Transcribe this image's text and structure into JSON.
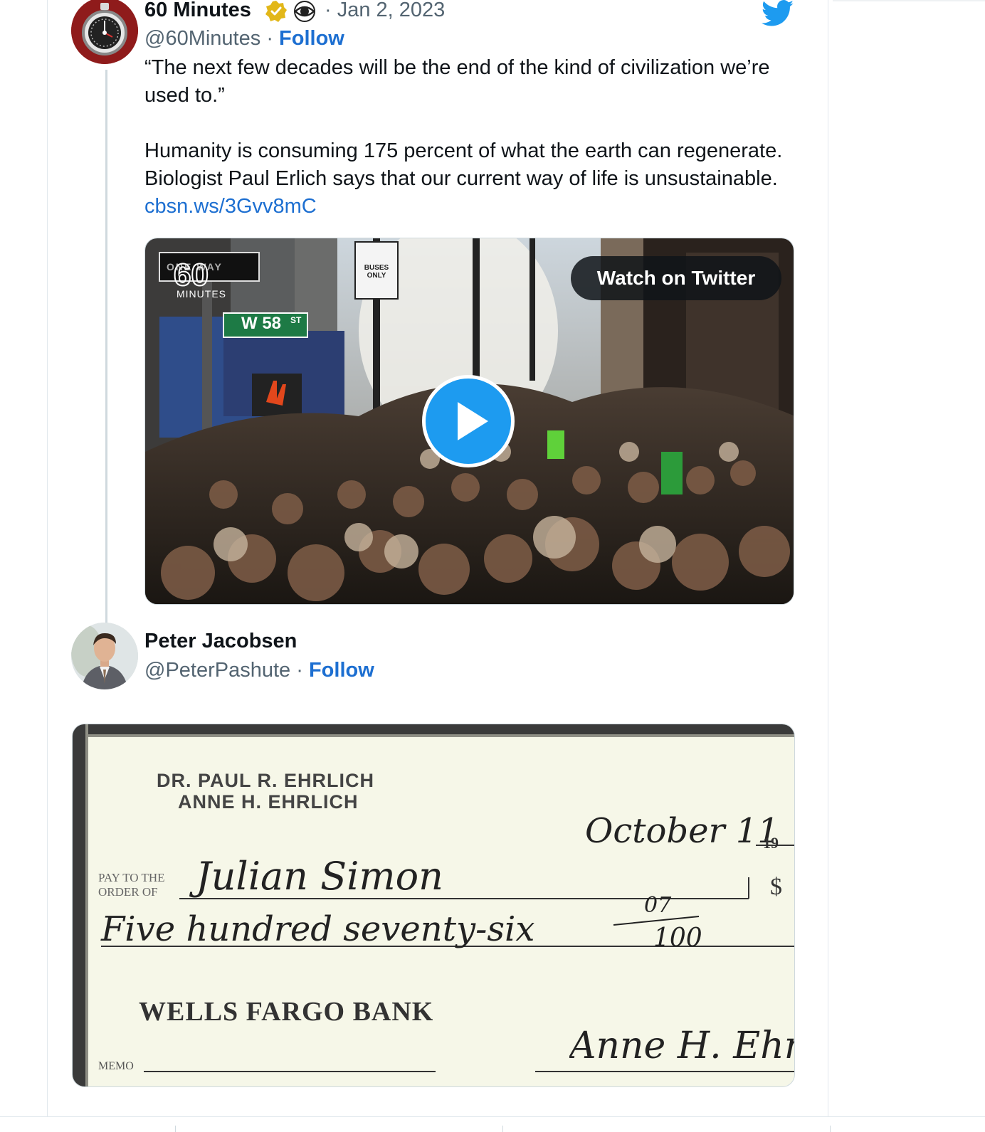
{
  "tweet1": {
    "author_name": "60 Minutes",
    "handle": "@60Minutes",
    "separator": "·",
    "follow_label": "Follow",
    "date": "· Jan 2, 2023",
    "text_line1": "“The next few decades will be the end of the kind of civilization we’re used to.”",
    "text_line2": "Humanity is consuming 175 percent of what the earth can regenerate. Biologist Paul Erlich says that our current way of life is unsustainable. ",
    "link": "cbsn.ws/3Gvv8mC",
    "media": {
      "watch_label": "Watch on Twitter",
      "logo_number": "60",
      "logo_word": "MINUTES",
      "street_sign": "W 58",
      "street_suffix": "ST",
      "oneway_sign": "ONE WAY",
      "bus_sign": "BUSES ONLY"
    }
  },
  "tweet2": {
    "author_name": "Peter Jacobsen",
    "handle": "@PeterPashute",
    "separator": "·",
    "follow_label": "Follow",
    "check": {
      "holder_line1": "DR. PAUL R. EHRLICH",
      "holder_line2": "ANNE H. EHRLICH",
      "date_script": "October 11",
      "year_prefix": "19",
      "pay_label_1": "PAY TO THE",
      "pay_label_2": "ORDER OF",
      "payee_script": "Julian Simon",
      "dollar_sign": "$",
      "amount_words": "Five hundred seventy-six",
      "cents_top": "07",
      "cents_bottom": "100",
      "bank": "WELLS FARGO BANK",
      "memo_label": "MEMO",
      "signature": "Anne H. Ehr"
    }
  },
  "colors": {
    "link": "#1d6fd1",
    "twitter_blue": "#1d9bf0",
    "verified_gold": "#e2b719",
    "avatar_red": "#9b1c1c"
  }
}
